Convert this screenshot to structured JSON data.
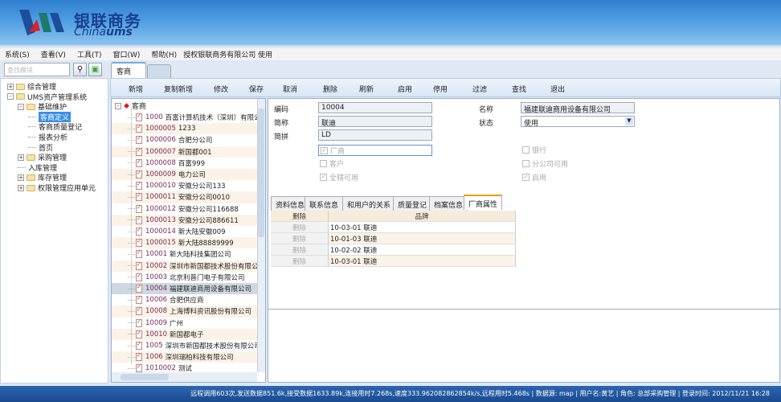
{
  "header": {
    "logo_cn": "银联商务",
    "logo_en_a": "China",
    "logo_en_b": "ums"
  },
  "menu": [
    "系统(S)",
    "查看(V)",
    "工具(T)",
    "窗口(W)",
    "帮助(H)",
    "授权银联商务有限公司 使用"
  ],
  "search": {
    "placeholder": "查找模块"
  },
  "nav_tree": [
    {
      "label": "综合管理",
      "level": 0,
      "expander": "+",
      "folder": true
    },
    {
      "label": "UMS资产管理系统",
      "level": 0,
      "expander": "-",
      "folder": true
    },
    {
      "label": "基础维护",
      "level": 1,
      "expander": "-",
      "folder": true
    },
    {
      "label": "客商定义",
      "level": 2,
      "selected": true
    },
    {
      "label": "客商质量登记",
      "level": 2
    },
    {
      "label": "报表分析",
      "level": 2
    },
    {
      "label": "首页",
      "level": 2
    },
    {
      "label": "采购管理",
      "level": 1,
      "expander": "+",
      "folder": true
    },
    {
      "label": "入库管理",
      "level": 1
    },
    {
      "label": "库存管理",
      "level": 1,
      "expander": "+",
      "folder": true
    },
    {
      "label": "权限管理应用单元",
      "level": 1,
      "expander": "+",
      "folder": true
    }
  ],
  "tabs": [
    "客商",
    ""
  ],
  "toolbar": [
    "新增",
    "复制新增",
    "修改",
    "保存",
    "取消",
    "删除",
    "刷新",
    "启用",
    "停用",
    "过滤",
    "查找",
    "退出"
  ],
  "list": {
    "root": "客商",
    "items": [
      {
        "code": "1000",
        "name": "百富计算机技术（深圳）有限公司"
      },
      {
        "code": "1000005",
        "name": "1233"
      },
      {
        "code": "1000006",
        "name": "合肥分公司"
      },
      {
        "code": "1000007",
        "name": "新国都001"
      },
      {
        "code": "1000008",
        "name": "百富999"
      },
      {
        "code": "1000009",
        "name": "电力公司"
      },
      {
        "code": "1000010",
        "name": "安徽分公司133"
      },
      {
        "code": "1000011",
        "name": "安徽分公司0010"
      },
      {
        "code": "1000012",
        "name": "安徽分公司116688",
        "green": true
      },
      {
        "code": "1000013",
        "name": "安徽分公司886611",
        "green": true
      },
      {
        "code": "1000014",
        "name": "新大陆安徽009"
      },
      {
        "code": "1000015",
        "name": "新大陆88889999"
      },
      {
        "code": "10001",
        "name": "新大陆科技集团公司"
      },
      {
        "code": "10002",
        "name": "深圳市新国都技术股份有限公司"
      },
      {
        "code": "10003",
        "name": "北京利普门电子有限公司"
      },
      {
        "code": "10004",
        "name": "福建联迪商用设备有限公司",
        "selected": true
      },
      {
        "code": "10006",
        "name": "合肥供应商"
      },
      {
        "code": "10008",
        "name": "上海博科资讯股份有限公司"
      },
      {
        "code": "10009",
        "name": "广州",
        "green": true
      },
      {
        "code": "10010",
        "name": "新国都电子"
      },
      {
        "code": "1005",
        "name": "深圳市新国都技术股份有限公司"
      },
      {
        "code": "1006",
        "name": "深圳瑞柏科技有限公司"
      },
      {
        "code": "1010002",
        "name": "测试"
      }
    ]
  },
  "form": {
    "code_label": "编码",
    "code": "10004",
    "name_label": "名称",
    "name": "福建联迪商用设备有限公司",
    "short_label": "简称",
    "short": "联迪",
    "status_label": "状态",
    "status": "使用",
    "pinyin_label": "简拼",
    "pinyin": "LD",
    "checks": [
      {
        "label": "厂商",
        "checked": true
      },
      {
        "label": "客户",
        "checked": false
      },
      {
        "label": "全辖可用",
        "checked": true
      },
      {
        "label": "银行",
        "checked": false
      },
      {
        "label": "分公司可用",
        "checked": false
      },
      {
        "label": "启用",
        "checked": true
      }
    ]
  },
  "subtabs": [
    "资料信息",
    "联系信息",
    "和用户的关系",
    "质量登记",
    "档案信息",
    "厂商属性"
  ],
  "active_subtab": "厂商属性",
  "grid": {
    "headers": [
      "删除",
      "品牌"
    ],
    "rows": [
      {
        "action": "删除",
        "brand": "10-03-01 联迪"
      },
      {
        "action": "删除",
        "brand": "10-01-03 联迪"
      },
      {
        "action": "删除",
        "brand": "10-02-02 联迪"
      },
      {
        "action": "删除",
        "brand": "10-03-01 联迪"
      }
    ]
  },
  "status": "远程调用603次,发送数据851.6k,接受数据1633.89k,连接用时7.268s,速度333.962082862854k/s,远程用时5.468s | 数据源: map | 用户名:黄艺 | 角色: 总部采购管理 | 登录时间: 2012/11/21 16:28",
  "colors": {
    "header": "#2f7fd0",
    "status_bar": "#1b4a8f",
    "selected": "#3a8ee6",
    "active_tab": "#e8a000"
  }
}
